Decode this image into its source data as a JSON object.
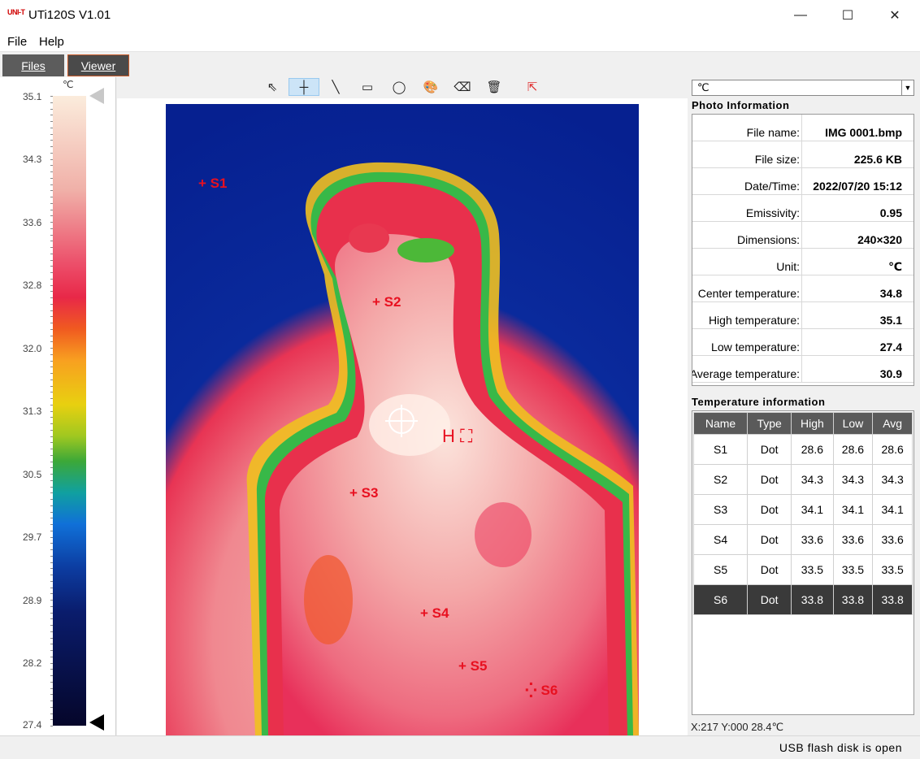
{
  "window": {
    "logo": "UNI-T",
    "title": "UTi120S V1.01",
    "minimize": "—",
    "maximize": "☐",
    "close": "✕"
  },
  "menu": {
    "file": "File",
    "help": "Help"
  },
  "tabs": {
    "files": "Files",
    "viewer": "Viewer"
  },
  "scale": {
    "unit": "℃",
    "ticks": [
      "35.1",
      "34.3",
      "33.6",
      "32.8",
      "32.0",
      "31.3",
      "30.5",
      "29.7",
      "28.9",
      "28.2",
      "27.4"
    ]
  },
  "toolbar": {
    "select": "⇖",
    "crosshair": "┼",
    "line": "╲",
    "rect": "▭",
    "circle": "◯",
    "palette": "🎨",
    "eraser": "⌫",
    "delete": "🗑",
    "export": "⇱"
  },
  "markers": [
    {
      "label": "S1"
    },
    {
      "label": "S2"
    },
    {
      "label": "S3"
    },
    {
      "label": "S4"
    },
    {
      "label": "S5"
    },
    {
      "label": "S6"
    },
    {
      "label": "H"
    }
  ],
  "unit_select": {
    "value": "℃",
    "arrow": "▼"
  },
  "photo_info": {
    "title": "Photo Information",
    "rows": [
      {
        "key": "File name:",
        "value": "IMG 0001.bmp"
      },
      {
        "key": "File size:",
        "value": "225.6 KB"
      },
      {
        "key": "Date/Time:",
        "value": "2022/07/20 15:12"
      },
      {
        "key": "Emissivity:",
        "value": "0.95"
      },
      {
        "key": "Dimensions:",
        "value": "240×320"
      },
      {
        "key": "Unit:",
        "value": "℃"
      },
      {
        "key": "Center temperature:",
        "value": "34.8"
      },
      {
        "key": "High temperature:",
        "value": "35.1"
      },
      {
        "key": "Low temperature:",
        "value": "27.4"
      },
      {
        "key": "Average temperature:",
        "value": "30.9"
      }
    ]
  },
  "temp_info": {
    "title": "Temperature information",
    "headers": [
      "Name",
      "Type",
      "High",
      "Low",
      "Avg"
    ],
    "rows": [
      [
        "S1",
        "Dot",
        "28.6",
        "28.6",
        "28.6"
      ],
      [
        "S2",
        "Dot",
        "34.3",
        "34.3",
        "34.3"
      ],
      [
        "S3",
        "Dot",
        "34.1",
        "34.1",
        "34.1"
      ],
      [
        "S4",
        "Dot",
        "33.6",
        "33.6",
        "33.6"
      ],
      [
        "S5",
        "Dot",
        "33.5",
        "33.5",
        "33.5"
      ],
      [
        "S6",
        "Dot",
        "33.8",
        "33.8",
        "33.8"
      ]
    ],
    "selected_row": 5
  },
  "cursor_readout": "X:217 Y:000   28.4℃",
  "status": "USB flash disk is open"
}
